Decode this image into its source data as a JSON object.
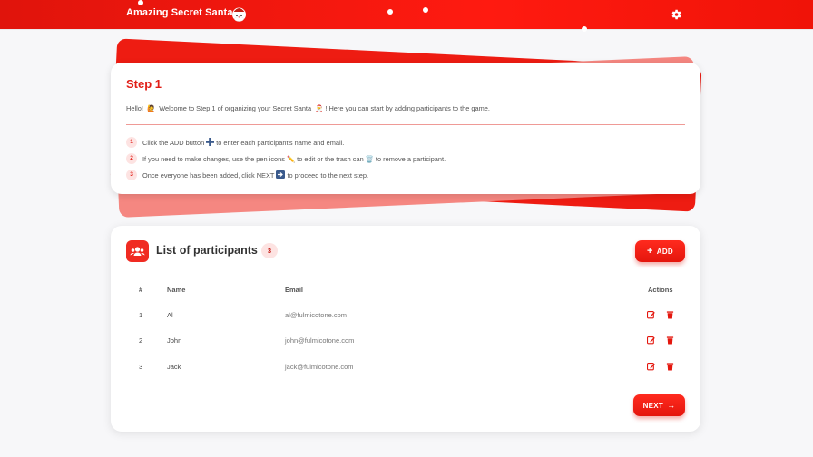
{
  "header": {
    "brand": "Amazing Secret Santa",
    "icons": [
      "santa-icon",
      "gear-icon"
    ],
    "color": "#ff1a10"
  },
  "step": {
    "title": "Step 1",
    "intro_start": "Hello! ",
    "intro_mid": " Welcome to Step 1 of organizing your Secret Santa ",
    "intro_end": "! Here you can start by adding participants to the game.",
    "instructions": [
      {
        "num": "1",
        "before": "Click the ADD button ",
        "after": " to enter each participant's name and email."
      },
      {
        "num": "2",
        "before": "If you need to make changes, use the pen icons ",
        "middle": " to edit or the trash can ",
        "after": " to remove a participant."
      },
      {
        "num": "3",
        "before": "Once everyone has been added, click NEXT ",
        "after": " to proceed to the next step."
      }
    ]
  },
  "participants": {
    "title": "List of participants",
    "count": "3",
    "add_label": "ADD",
    "next_label": "NEXT",
    "columns": [
      "#",
      "Name",
      "Email",
      "Actions"
    ],
    "rows": [
      {
        "num": "1",
        "name": "Al",
        "email": "al@fulmicotone.com"
      },
      {
        "num": "2",
        "name": "John",
        "email": "john@fulmicotone.com"
      },
      {
        "num": "3",
        "name": "Jack",
        "email": "jack@fulmicotone.com"
      }
    ]
  },
  "colors": {
    "accent": "#e11d16",
    "badge_bg": "#fde3e2"
  }
}
